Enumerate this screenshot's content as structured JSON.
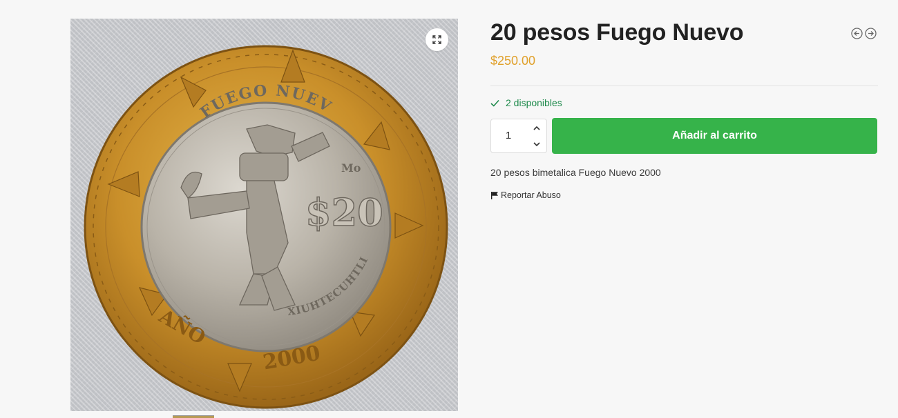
{
  "product": {
    "title": "20 pesos Fuego Nuevo",
    "price": "$250.00",
    "stock": "2 disponibles",
    "quantity": "1",
    "add_to_cart_label": "Añadir al carrito",
    "description": "20 pesos bimetalica Fuego Nuevo 2000",
    "report_label": "Reportar Abuso"
  },
  "coin_image": {
    "top_text": "FUEGO NUEVO",
    "denomination": "$20",
    "side_text": "XIUHTECUHTLI",
    "mint_mark": "Mo",
    "year_label": "AÑO",
    "year": "2000"
  },
  "icons": {
    "zoom": "expand-icon",
    "prev": "arrow-left-circle-icon",
    "next": "arrow-right-circle-icon",
    "stock": "check-icon",
    "qty_up": "chevron-up-icon",
    "qty_down": "chevron-down-icon",
    "report": "flag-icon"
  },
  "colors": {
    "price": "#e0a12c",
    "button": "#36b34a",
    "stock": "#1f8a4c",
    "background": "#f7f7f7"
  }
}
